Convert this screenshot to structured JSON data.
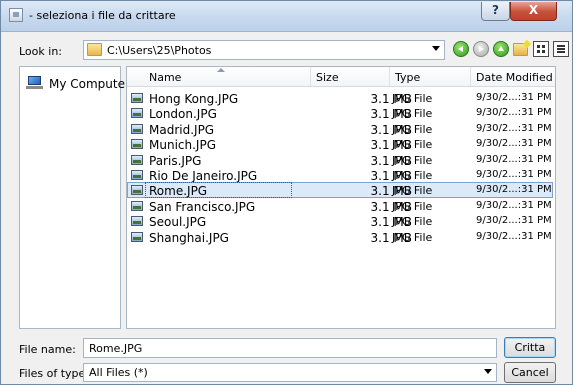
{
  "window": {
    "title": "- seleziona i file da crittare",
    "help_glyph": "?",
    "close_glyph": "X"
  },
  "toolbar": {
    "look_in_label": "Look in:",
    "path": "C:\\Users\\25\\Photos",
    "icons": [
      "back-icon",
      "forward-icon",
      "up-folder-icon",
      "new-folder-icon",
      "grid-view-icon",
      "list-view-icon"
    ]
  },
  "places": {
    "items": [
      {
        "label": "My Computer",
        "icon": "computer-icon"
      }
    ]
  },
  "filelist": {
    "columns": [
      "Name",
      "Size",
      "Type",
      "Date Modified"
    ],
    "sorted_by": "Name",
    "selected": "Rome.JPG",
    "rows": [
      {
        "name": "Hong Kong.JPG",
        "size": "3.1 MB",
        "type": "JPG File",
        "date": "9/30/2...:31 PM"
      },
      {
        "name": "London.JPG",
        "size": "3.1 MB",
        "type": "JPG File",
        "date": "9/30/2...:31 PM"
      },
      {
        "name": "Madrid.JPG",
        "size": "3.1 MB",
        "type": "JPG File",
        "date": "9/30/2...:31 PM"
      },
      {
        "name": "Munich.JPG",
        "size": "3.1 MB",
        "type": "JPG File",
        "date": "9/30/2...:31 PM"
      },
      {
        "name": "Paris.JPG",
        "size": "3.1 MB",
        "type": "JPG File",
        "date": "9/30/2...:31 PM"
      },
      {
        "name": "Rio De Janeiro.JPG",
        "size": "3.1 MB",
        "type": "JPG File",
        "date": "9/30/2...:31 PM"
      },
      {
        "name": "Rome.JPG",
        "size": "3.1 MB",
        "type": "JPG File",
        "date": "9/30/2...:31 PM"
      },
      {
        "name": "San Francisco.JPG",
        "size": "3.1 MB",
        "type": "JPG File",
        "date": "9/30/2...:31 PM"
      },
      {
        "name": "Seoul.JPG",
        "size": "3.1 MB",
        "type": "JPG File",
        "date": "9/30/2...:31 PM"
      },
      {
        "name": "Shanghai.JPG",
        "size": "3.1 MB",
        "type": "JPG File",
        "date": "9/30/2...:31 PM"
      }
    ]
  },
  "footer": {
    "file_name_label": "File name:",
    "file_name_value": "Rome.JPG",
    "files_of_type_label": "Files of type:",
    "files_of_type_value": "All Files (*)",
    "primary_button": "Critta",
    "cancel_button": "Cancel"
  },
  "colors": {
    "selection_fill": "#dbe9f8",
    "selection_border": "#7da2ce",
    "close_button": "#c5503a"
  }
}
